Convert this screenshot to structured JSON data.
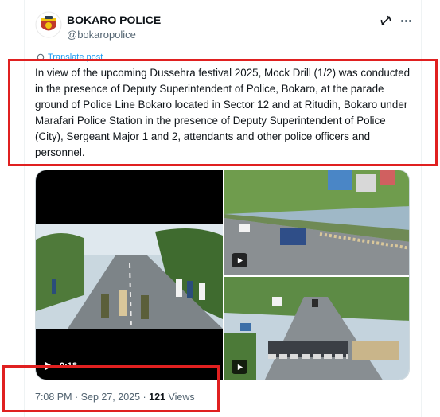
{
  "author": {
    "name": "BOKARO POLICE",
    "handle": "@bokaropolice",
    "avatar_icon": "police-emblem-icon"
  },
  "header_actions": {
    "grok_icon": "grok-icon",
    "more_icon": "more-options-icon"
  },
  "translate_label": "Translate post",
  "post_text": "In view of the upcoming Dussehra festival 2025, Mock Drill (1/2) was conducted in the presence of Deputy Superintendent of Police, Bokaro, at the parade ground of Police Line Bokaro located in Sector 12 and at Ritudih, Bokaro under Marafari Police Station in the presence of Deputy Superintendent of Police (City), Sergeant Major 1 and 2, attendants and other police officers and personnel.",
  "media": {
    "video_duration": "0:18",
    "items": [
      "video",
      "photo-video",
      "photo-video"
    ]
  },
  "meta": {
    "time": "7:08 PM",
    "separator1": " · ",
    "date": "Sep 27, 2025",
    "separator2": " · ",
    "views_count": "121",
    "views_label": " Views"
  },
  "colors": {
    "highlight": "#e02020",
    "link": "#1d9bf0",
    "secondary_text": "#536471"
  }
}
